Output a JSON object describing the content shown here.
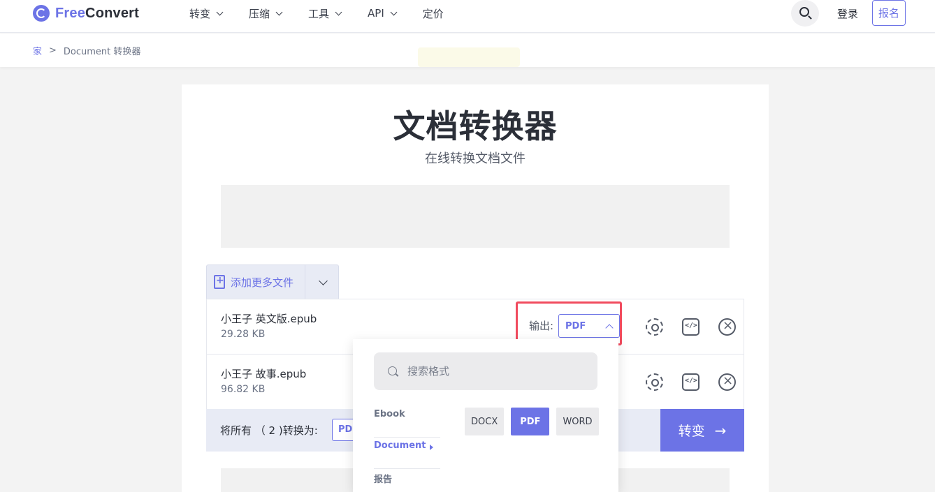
{
  "header": {
    "logo_free": "Free",
    "logo_convert": "Convert",
    "nav": [
      {
        "label": "转变"
      },
      {
        "label": "压缩"
      },
      {
        "label": "工具"
      },
      {
        "label": "API"
      },
      {
        "label": "定价"
      }
    ],
    "login": "登录",
    "signup": "报名"
  },
  "breadcrumb": {
    "home": "家",
    "separator": ">",
    "current": "Document 转换器"
  },
  "page": {
    "title": "文档转换器",
    "subtitle": "在线转换文档文件"
  },
  "add_files": {
    "label": "添加更多文件"
  },
  "files": [
    {
      "name": "小王子 英文版.epub",
      "size": "29.28 KB"
    },
    {
      "name": "小王子 故事.epub",
      "size": "96.82 KB"
    }
  ],
  "output": {
    "label": "输出:",
    "value": "PDF"
  },
  "convert_all": {
    "label": "将所有 （ 2 )转换为:",
    "value": "PDF",
    "button": "转变",
    "arrow": "→"
  },
  "dropdown": {
    "search_placeholder": "搜索格式",
    "categories": [
      {
        "label": "Ebook"
      },
      {
        "label": "Document"
      },
      {
        "label": "报告"
      }
    ],
    "formats": [
      {
        "label": "DOCX"
      },
      {
        "label": "PDF"
      },
      {
        "label": "WORD"
      }
    ]
  },
  "colors": {
    "accent": "#6c73e6",
    "highlight_border": "#f14b5e"
  }
}
